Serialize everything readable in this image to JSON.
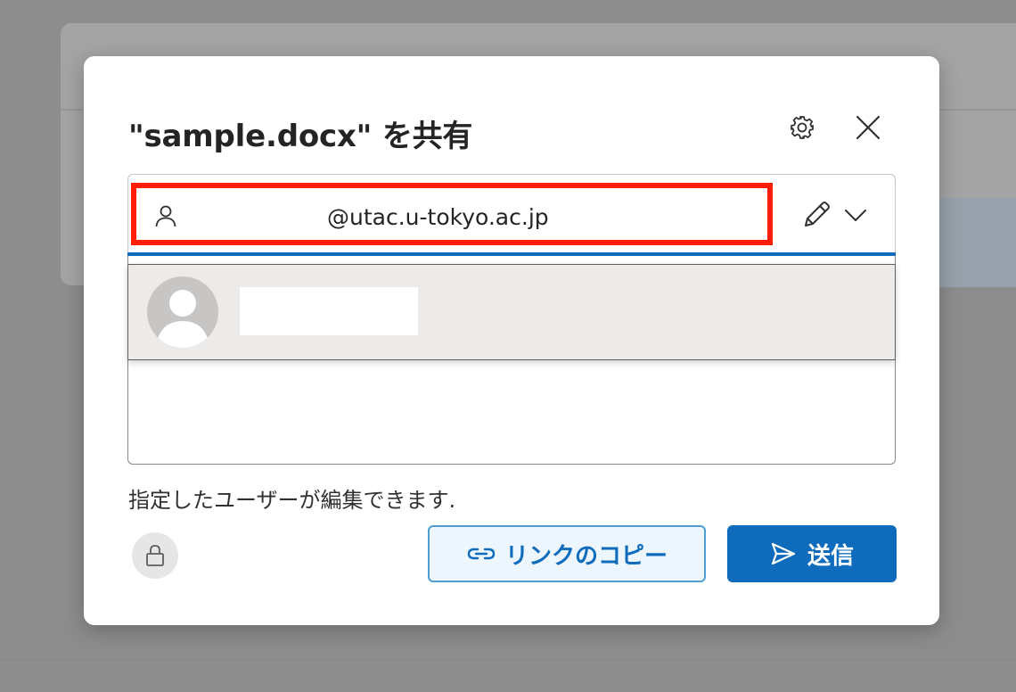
{
  "dialog": {
    "title": "\"sample.docx\" を共有",
    "settings_icon": "gear-icon",
    "close_icon": "close-icon"
  },
  "recipient": {
    "icon": "person-icon",
    "email": "@utac.u-tokyo.ac.jp",
    "permission_icon": "pencil-icon",
    "dropdown_icon": "chevron-down-icon"
  },
  "suggestion": {
    "avatar_icon": "person-avatar-icon"
  },
  "permission_note": "指定したユーザーが編集できます.",
  "buttons": {
    "lock_icon": "lock-icon",
    "copy_link_label": "リンクのコピー",
    "copy_link_icon": "link-icon",
    "send_label": "送信",
    "send_icon": "send-icon"
  },
  "colors": {
    "accent": "#0f6cbd",
    "highlight_border": "#ff1f00",
    "suggestion_bg": "#edebe9"
  }
}
